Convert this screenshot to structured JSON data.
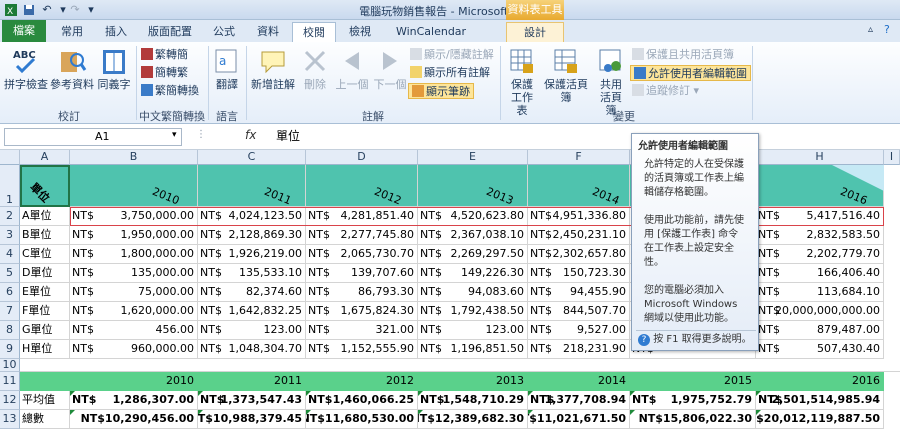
{
  "window": {
    "title": "電腦玩物銷售報告 - Microsoft Excel",
    "context_group": "資料表工具"
  },
  "tabs": [
    "檔案",
    "常用",
    "插入",
    "版面配置",
    "公式",
    "資料",
    "校閱",
    "檢視",
    "WinCalendar",
    "設計"
  ],
  "ribbon": {
    "groups": [
      "校訂",
      "中文繁簡轉換",
      "語言",
      "註解",
      "變更"
    ],
    "proofing": [
      "拼字檢查",
      "參考資料",
      "同義字"
    ],
    "chinese": [
      "繁轉簡",
      "簡轉繁",
      "繁簡轉換"
    ],
    "language": [
      "翻譯"
    ],
    "comments_big": [
      "新增註解",
      "刪除",
      "上一個",
      "下一個"
    ],
    "comments_small": [
      "顯示/隱藏註解",
      "顯示所有註解",
      "顯示筆跡"
    ],
    "changes_big": [
      "保護工作表",
      "保護活頁簿",
      "共用活頁簿"
    ],
    "changes_small": [
      "保護且共用活頁簿",
      "允許使用者編輯範圍",
      "追蹤修訂"
    ]
  },
  "formula_bar": {
    "name_box": "A1",
    "fx": "fx",
    "value": "單位"
  },
  "columns": [
    "A",
    "B",
    "C",
    "D",
    "E",
    "F",
    "G",
    "H",
    "I"
  ],
  "header_row": {
    "a1": "單位",
    "years": [
      "2010",
      "2011",
      "2012",
      "2013",
      "2014",
      "2015",
      "2016"
    ]
  },
  "currency": "NT$",
  "rows": [
    {
      "label": "A單位",
      "values": [
        "3,750,000.00",
        "4,024,123.50",
        "4,281,851.40",
        "4,520,623.80",
        "4,951,336.80",
        "",
        "5,417,516.40"
      ]
    },
    {
      "label": "B單位",
      "values": [
        "1,950,000.00",
        "2,128,869.30",
        "2,277,745.80",
        "2,367,038.10",
        "2,450,231.10",
        "",
        "2,832,583.50"
      ]
    },
    {
      "label": "C單位",
      "values": [
        "1,800,000.00",
        "1,926,219.00",
        "2,065,730.70",
        "2,269,297.50",
        "2,302,657.80",
        "",
        "2,202,779.70"
      ]
    },
    {
      "label": "D單位",
      "values": [
        "135,000.00",
        "135,533.10",
        "139,707.60",
        "149,226.30",
        "150,723.30",
        "",
        "166,406.40"
      ]
    },
    {
      "label": "E單位",
      "values": [
        "75,000.00",
        "82,374.60",
        "86,793.30",
        "94,083.60",
        "94,455.90",
        "",
        "113,684.10"
      ]
    },
    {
      "label": "F單位",
      "values": [
        "1,620,000.00",
        "1,642,832.25",
        "1,675,824.30",
        "1,792,438.50",
        "844,507.70",
        "",
        "20,000,000,000.00"
      ]
    },
    {
      "label": "G單位",
      "values": [
        "456.00",
        "123.00",
        "321.00",
        "123.00",
        "9,527.00",
        "",
        "879,487.00"
      ]
    },
    {
      "label": "H單位",
      "values": [
        "960,000.00",
        "1,048,304.70",
        "1,152,555.90",
        "1,196,851.50",
        "218,231.90",
        "",
        "507,430.40"
      ]
    }
  ],
  "summary_header_years": [
    "2010",
    "2011",
    "2012",
    "2013",
    "2014",
    "2015",
    "2016"
  ],
  "average": {
    "label": "平均值",
    "values": [
      "1,286,307.00",
      "1,373,547.43",
      "1,460,066.25",
      "1,548,710.29",
      "1,377,708.94",
      "1,975,752.79",
      "2,501,514,985.94"
    ]
  },
  "total": {
    "label": "總數",
    "values": [
      "NT$10,290,456.00",
      "NT$10,988,379.45",
      "NT$11,680,530.00",
      "NT$12,389,682.30",
      "NT$11,021,671.50",
      "NT$15,806,022.30",
      "NT$20,012,119,887.50"
    ]
  },
  "tooltip": {
    "title": "允許使用者編輯範圍",
    "body": [
      "允許特定的人在受保護",
      "的活頁簿或工作表上編",
      "輯儲存格範圍。",
      "",
      "使用此功能前，請先使",
      "用 [保護工作表] 命令",
      "在工作表上設定安全",
      "性。",
      "",
      "您的電腦必須加入",
      "Microsoft Windows",
      "網域以使用此功能。"
    ],
    "help": "按 F1 取得更多說明。"
  },
  "colors": {
    "header_teal": "#4fc3ae",
    "summary_green": "#5ad18b",
    "file_tab": "#2a8a3e",
    "highlight": "#fde59a"
  }
}
